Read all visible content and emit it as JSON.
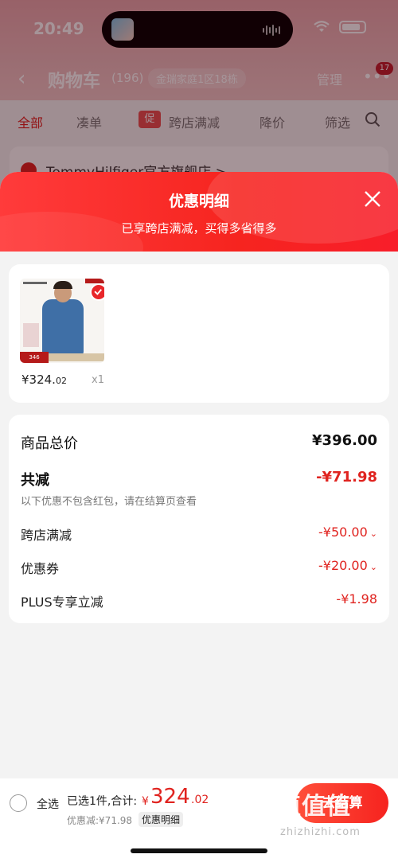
{
  "status_bar": {
    "time": "20:49"
  },
  "cart_header": {
    "title": "购物车",
    "count": "(196)",
    "location": "金瑞家庭1区18栋",
    "manage": "管理",
    "badge": "17"
  },
  "tabs": {
    "all": "全部",
    "bundle": "凑单",
    "promo_tag": "促",
    "cross_store": "跨店满减",
    "price_drop": "降价",
    "filter": "筛选"
  },
  "store": {
    "name": "TommyHilfiger官方旗舰店 >"
  },
  "sheet": {
    "title": "优惠明细",
    "subtitle": "已享跨店满减，买得多省得多"
  },
  "product": {
    "price_int": "¥324.",
    "price_dec": "02",
    "qty": "x1",
    "thumb_price": "346"
  },
  "summary": {
    "total_label": "商品总价",
    "total_value": "¥396.00",
    "discount_label": "共减",
    "discount_value": "-¥71.98",
    "note": "以下优惠不包含红包，请在结算页查看",
    "items": [
      {
        "label": "跨店满减",
        "value": "-¥50.00",
        "has_caret": true
      },
      {
        "label": "优惠券",
        "value": "-¥20.00",
        "has_caret": true
      },
      {
        "label": "PLUS专享立减",
        "value": "-¥1.98",
        "has_caret": false
      }
    ]
  },
  "bottom_bar": {
    "select_all": "全选",
    "selected": "已选1件,合计:",
    "total_yen": "¥",
    "total_amount": "324",
    "total_dec": ".02",
    "discount_text": "优惠减:¥71.98",
    "discount_detail": "优惠明细",
    "checkout": "去结算",
    "watermark": "值值值",
    "watermark_url": "zhizhizhi.com"
  },
  "colors": {
    "accent": "#e0231f",
    "sheet_header": "#f6241f"
  }
}
